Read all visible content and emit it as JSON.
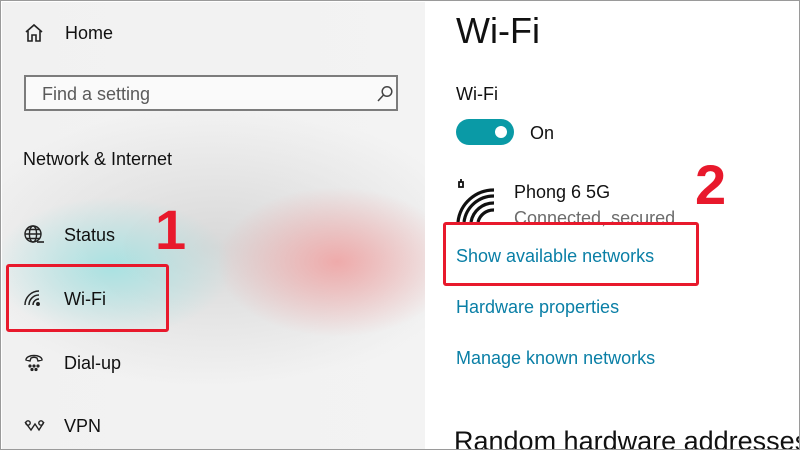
{
  "nav": {
    "home_label": "Home",
    "search_placeholder": "Find a setting",
    "section_title": "Network & Internet",
    "items": [
      {
        "label": "Status",
        "icon": "globe-icon"
      },
      {
        "label": "Wi-Fi",
        "icon": "wifi-icon"
      },
      {
        "label": "Dial-up",
        "icon": "phone-icon"
      },
      {
        "label": "VPN",
        "icon": "vpn-icon"
      }
    ]
  },
  "annotations": {
    "step1": "1",
    "step2": "2",
    "highlight_color": "#e8192c"
  },
  "content": {
    "title": "Wi-Fi",
    "wifi_label": "Wi-Fi",
    "toggle_state": "On",
    "toggle_on": true,
    "accent_color": "#0a9aa6",
    "network": {
      "name": "Phong 6 5G",
      "status": "Connected, secured"
    },
    "links": {
      "show_networks": "Show available networks",
      "hardware_properties": "Hardware properties",
      "manage_known": "Manage known networks"
    },
    "random_hw_heading": "Random hardware addresses"
  }
}
